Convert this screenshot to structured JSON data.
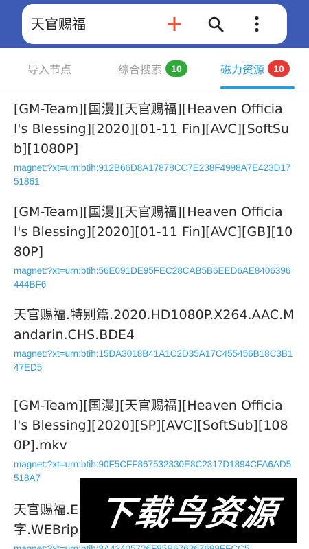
{
  "header": {
    "query": "天官赐福",
    "icons": {
      "add": "plus-icon",
      "search": "search-icon",
      "more": "more-vert-icon"
    },
    "accent": "#f0502e",
    "bar_color": "#3d5ab5"
  },
  "tabs": [
    {
      "label": "导入节点",
      "badge": null
    },
    {
      "label": "综合搜索",
      "badge": "10",
      "badge_color": "#33a83a"
    },
    {
      "label": "磁力资源",
      "badge": "10",
      "badge_color": "#e53935",
      "active": true
    }
  ],
  "results": [
    {
      "title": "[GM-Team][国漫][天官赐福][Heaven Official's Blessing][2020][01-11 Fin][AVC][SoftSub][1080P]",
      "magnet": "magnet:?xt=urn:btih:912B66D8A17878CC7E238F4998A7E423D1751861"
    },
    {
      "title": "[GM-Team][国漫][天官赐福][Heaven Official's Blessing][2020][01-11 Fin][AVC][GB][1080P]",
      "magnet": "magnet:?xt=urn:btih:56E091DE95FEC28CAB5B6EED6AE8406396444BF6"
    },
    {
      "title": "天官赐福.特别篇.2020.HD1080P.X264.AAC.Mandarin.CHS.BDE4",
      "magnet": "magnet:?xt=urn:btih:15DA3018B41A1C2D35A17C455456B18C3B147ED5"
    },
    {
      "title": "[GM-Team][国漫][天官赐福][Heaven Official's Blessing][2020][SP][AVC][SoftSub][1080P].mkv",
      "magnet": "magnet:?xt=urn:btih:90F5CFF867532330E8C2317D1894CFA6AD5518A7"
    },
    {
      "title": "天官赐福.E",
      "title_line2": "字.WEBrip.",
      "magnet": "magnet:?xt=urn:btih:8A42405726F85B676367699FFCC5"
    }
  ],
  "watermark": {
    "text": "下载鸟资源"
  },
  "colors": {
    "link": "#2f9ad8",
    "active_tab": "#2f9ad8",
    "inactive_tab": "#9a9a9a"
  }
}
